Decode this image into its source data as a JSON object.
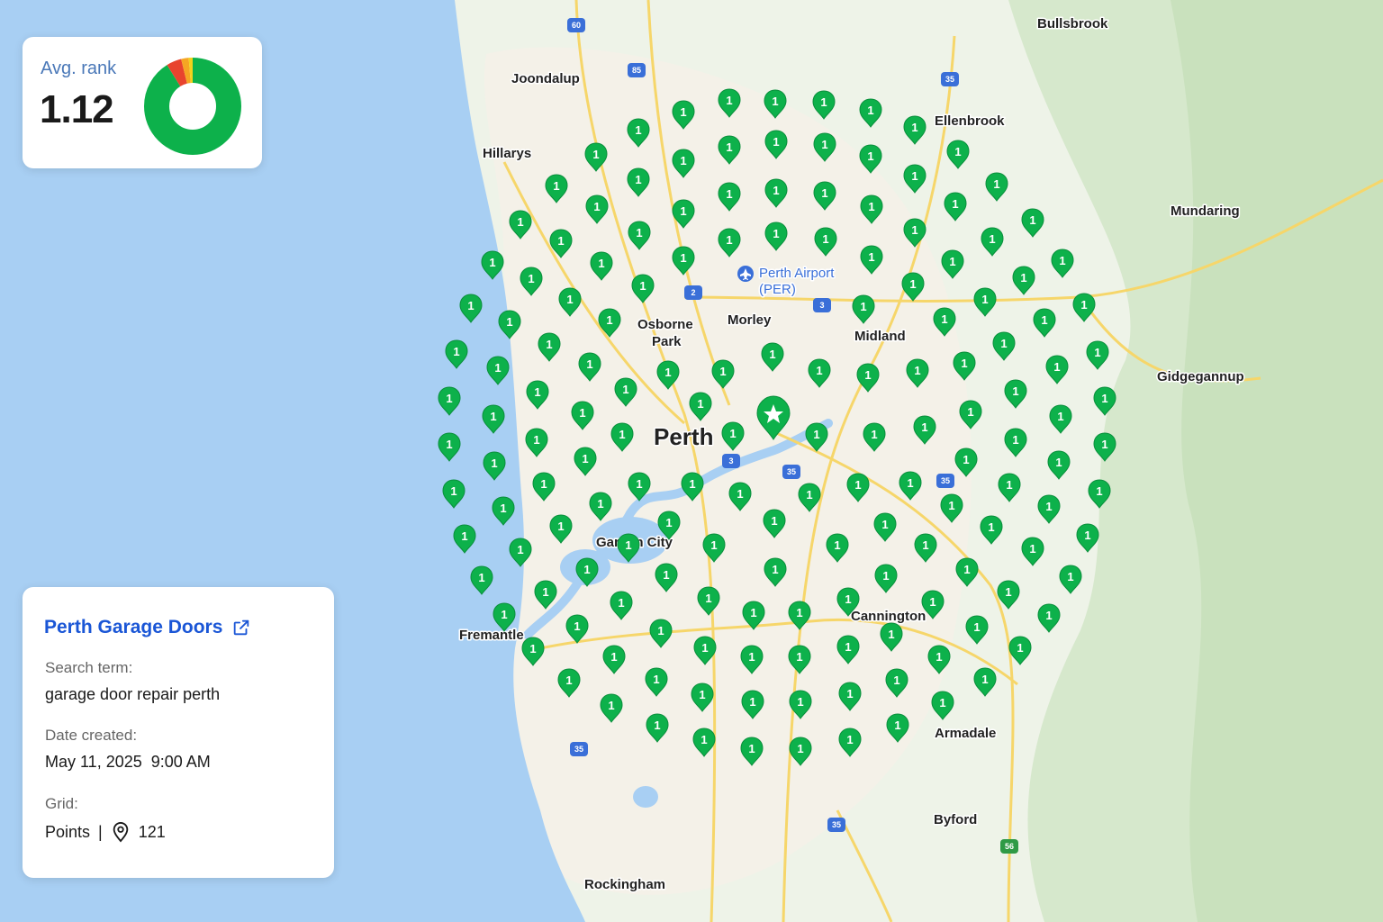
{
  "rank_card": {
    "label": "Avg. rank",
    "value": "1.12",
    "donut": [
      {
        "fraction": 0.91,
        "color": "#0db14b"
      },
      {
        "fraction": 0.05,
        "color": "#e8442e"
      },
      {
        "fraction": 0.025,
        "color": "#f5a623"
      },
      {
        "fraction": 0.015,
        "color": "#f2d21b"
      }
    ]
  },
  "info_card": {
    "business_name": "Perth Garage Doors",
    "search_term_label": "Search term:",
    "search_term": "garage door repair perth",
    "date_label": "Date created:",
    "date_value": "May 11, 2025  9:00 AM",
    "grid_label": "Grid:",
    "grid_type": "Points",
    "grid_separator": "|",
    "grid_points": "121"
  },
  "map": {
    "places": [
      "Bullsbrook",
      "Joondalup",
      "Ellenbrook",
      "Hillarys",
      "Mundaring",
      "Perth Airport",
      "(PER)",
      "Osborne",
      "Park",
      "Morley",
      "Midland",
      "Gidgegannup",
      "Perth",
      "Garden City",
      "Cannington",
      "Fremantle",
      "Armadale",
      "Byford",
      "Rockingham"
    ],
    "highway_shields": [
      "60",
      "85",
      "35",
      "2",
      "3",
      "3",
      "35",
      "35",
      "35",
      "35",
      "56"
    ],
    "pin_rank": "1",
    "pin_color": "#0db14b",
    "center_marker": "star-icon",
    "water_color": "#a8cff3"
  }
}
